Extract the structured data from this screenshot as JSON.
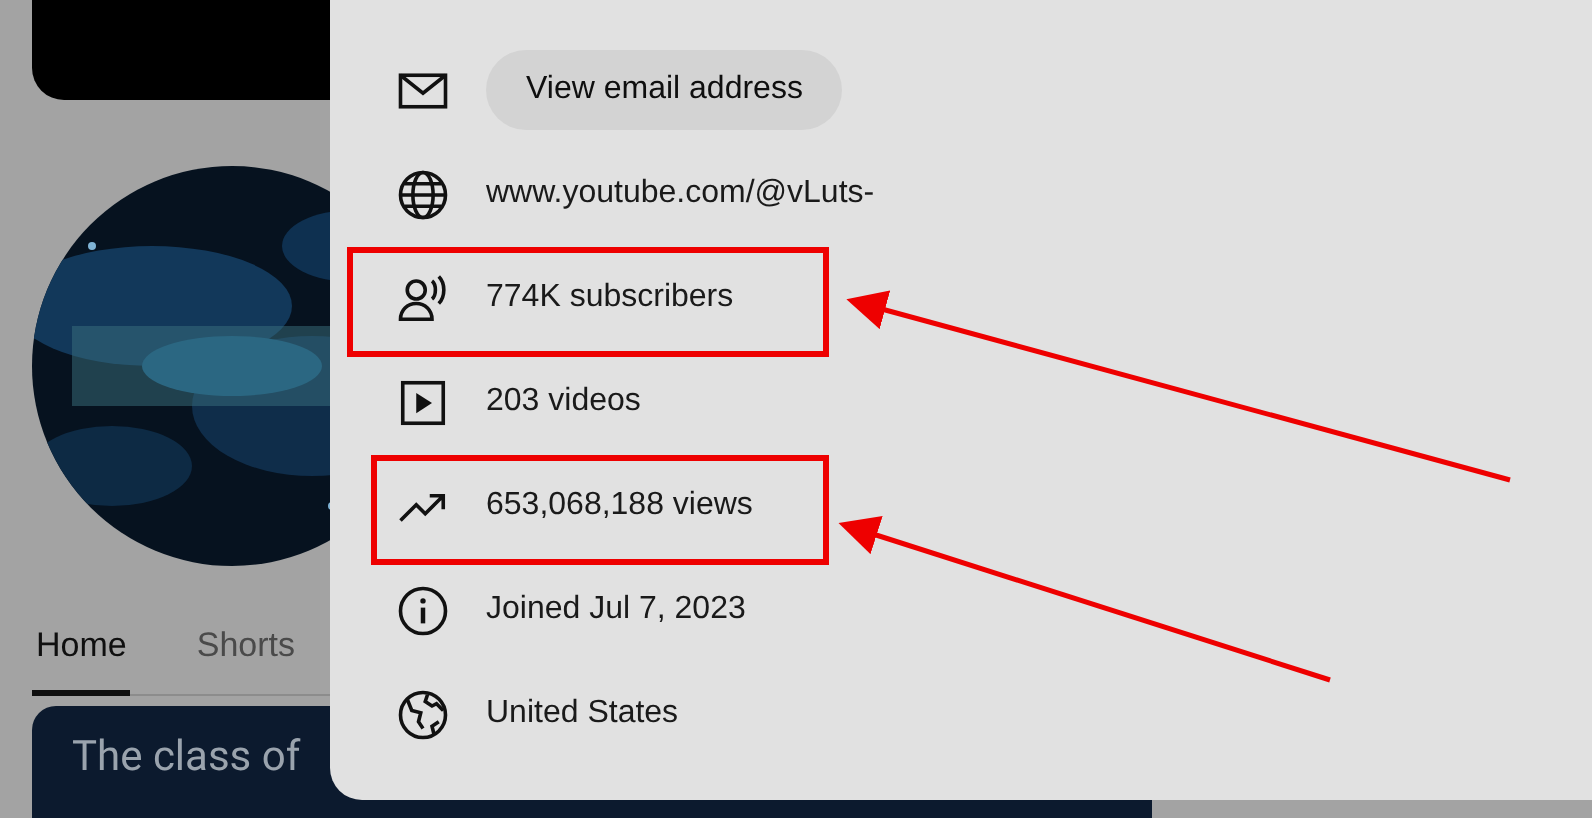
{
  "tabs": [
    {
      "label": "Home",
      "selected": true
    },
    {
      "label": "Shorts",
      "selected": false
    }
  ],
  "video_card": {
    "title": "The class of"
  },
  "details": [
    {
      "kind": "button",
      "label": "View email address",
      "highlighted": false
    },
    {
      "kind": "text",
      "label": "www.youtube.com/@vLuts-",
      "highlighted": false
    },
    {
      "kind": "text",
      "label": "774K subscribers",
      "highlighted": true
    },
    {
      "kind": "text",
      "label": "203 videos",
      "highlighted": false
    },
    {
      "kind": "text",
      "label": "653,068,188 views",
      "highlighted": true
    },
    {
      "kind": "text",
      "label": "Joined Jul 7, 2023",
      "highlighted": false
    },
    {
      "kind": "text",
      "label": "United States",
      "highlighted": false
    }
  ]
}
